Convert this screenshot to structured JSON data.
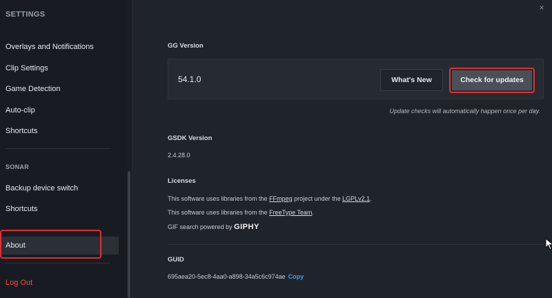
{
  "sidebar": {
    "header": "SETTINGS",
    "items": [
      {
        "label": "Overlays and Notifications"
      },
      {
        "label": "Clip Settings"
      },
      {
        "label": "Game Detection"
      },
      {
        "label": "Auto-clip"
      },
      {
        "label": "Shortcuts"
      }
    ],
    "sonar_header": "SONAR",
    "sonar_items": [
      {
        "label": "Backup device switch"
      },
      {
        "label": "Shortcuts"
      }
    ],
    "about_label": "About",
    "logout_label": "Log Out"
  },
  "main": {
    "close_icon": "×",
    "gg": {
      "title": "GG Version",
      "version": "54.1.0",
      "whats_new_label": "What's New",
      "check_label": "Check for updates",
      "note": "Update checks will automatically happen once per day."
    },
    "gsdk": {
      "title": "GSDK Version",
      "version": "2.4.28.0"
    },
    "licenses": {
      "title": "Licenses",
      "line1_prefix": "This software uses libraries from the ",
      "line1_link1": "FFmpeg",
      "line1_mid": " project under the ",
      "line1_link2": "LGPLv2.1",
      "line1_suffix": ".",
      "line2_prefix": "This software uses libraries from the ",
      "line2_link": "FreeType Team",
      "line2_suffix": ".",
      "line3_prefix": "GIF search powered by ",
      "line3_brand": "GIPHY"
    },
    "guid": {
      "title": "GUID",
      "value": "695aea20-5ec8-4aa0-a898-34a5c6c974ae",
      "copy_label": "Copy"
    }
  },
  "colors": {
    "accent_red": "#e03030",
    "logout_red": "#ff4b3e",
    "link_blue": "#3e9cf0"
  }
}
